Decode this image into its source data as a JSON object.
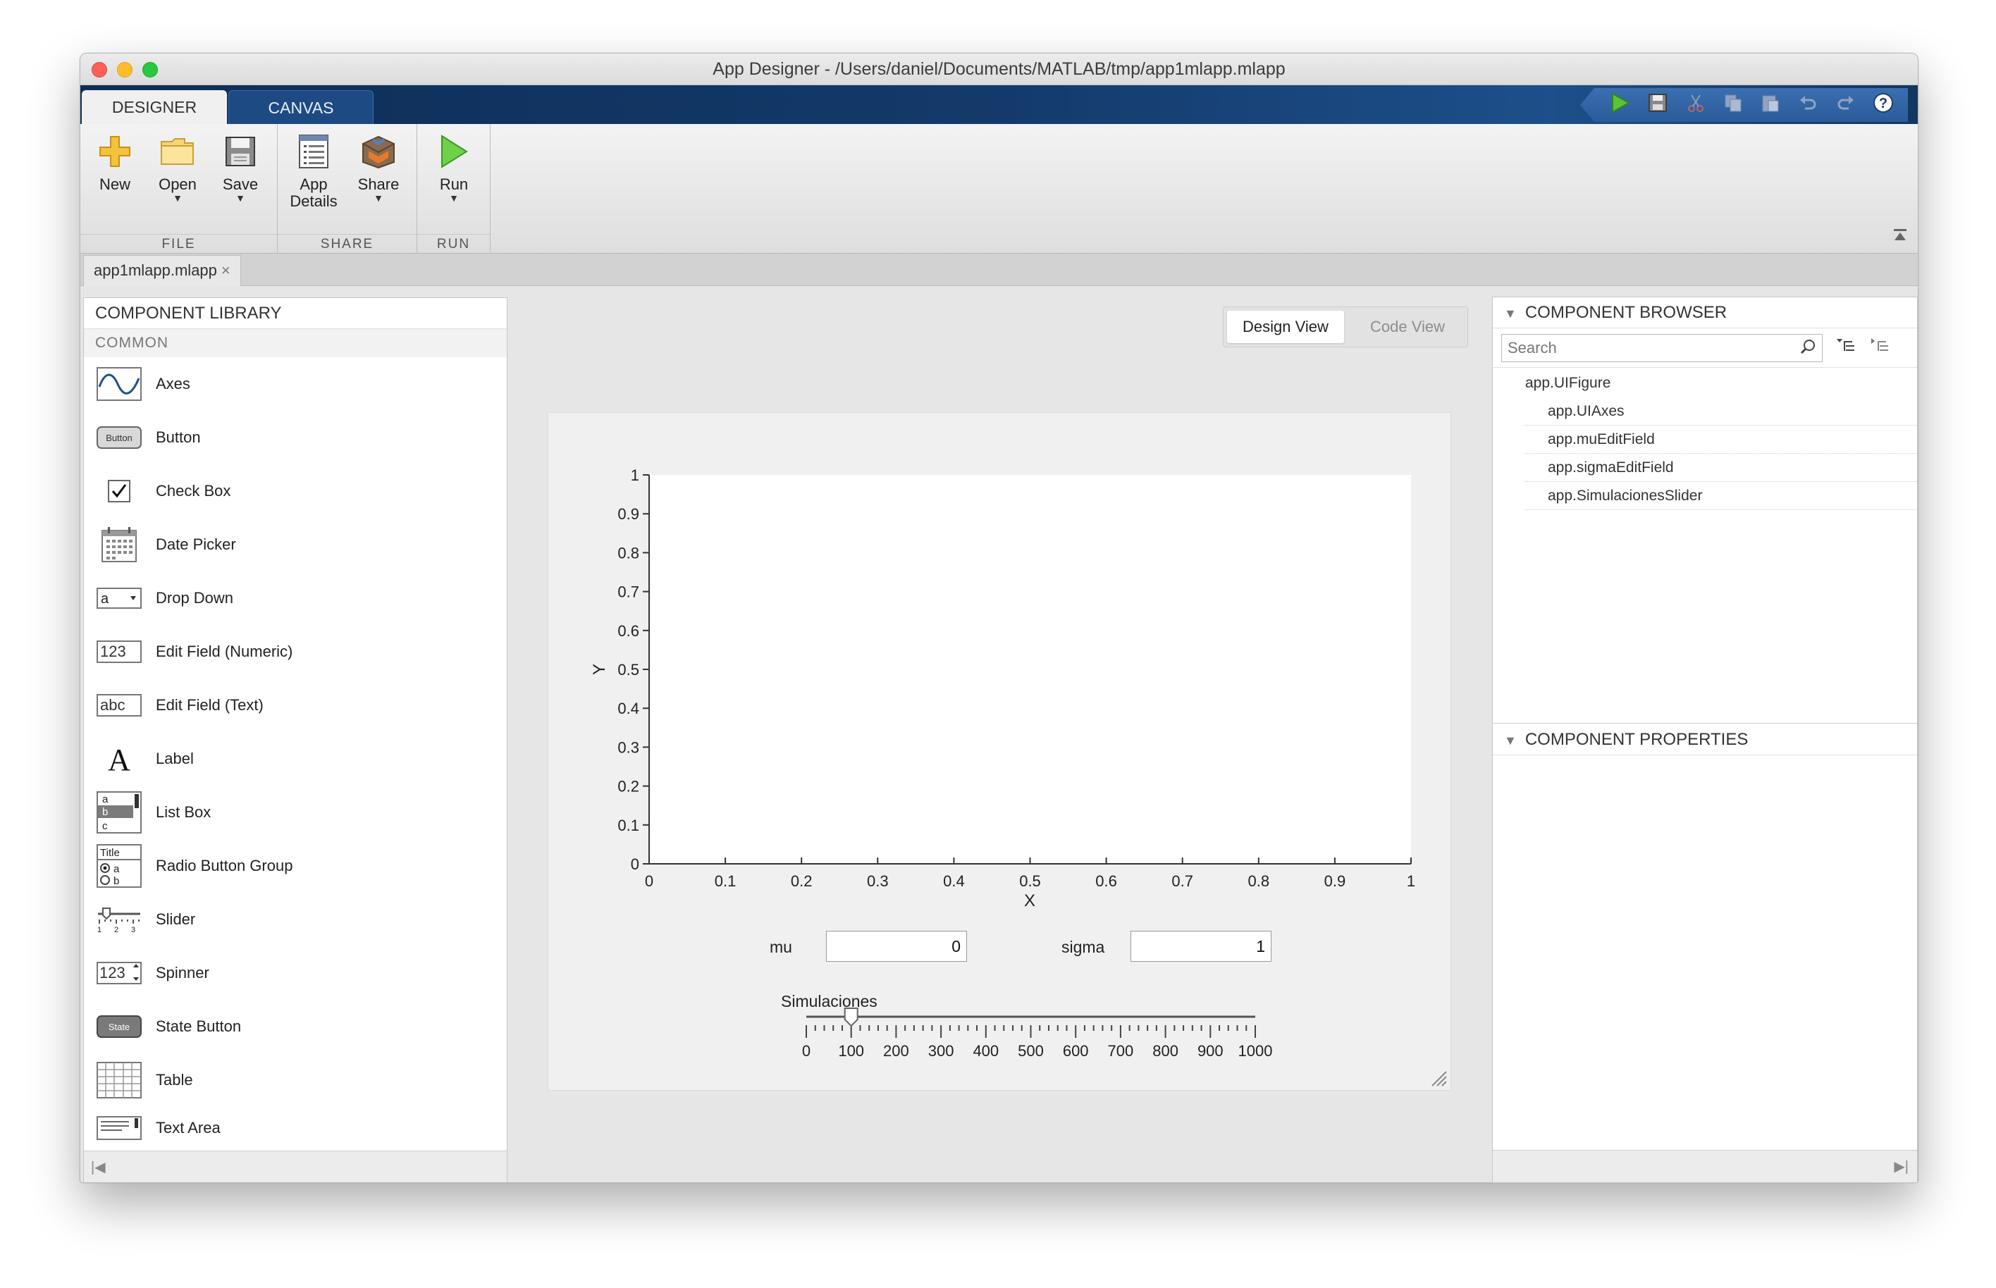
{
  "window": {
    "title": "App Designer - /Users/daniel/Documents/MATLAB/tmp/app1mlapp.mlapp"
  },
  "tabs": {
    "designer": "DESIGNER",
    "canvas": "CANVAS"
  },
  "quick_access": [
    "run-icon",
    "save-icon",
    "cut-icon",
    "copy-icon",
    "paste-icon",
    "undo-icon",
    "redo-icon",
    "help-icon"
  ],
  "toolstrip": {
    "file": {
      "label": "FILE",
      "new": "New",
      "open": "Open",
      "save": "Save"
    },
    "share": {
      "label": "SHARE",
      "app_details_1": "App",
      "app_details_2": "Details",
      "share": "Share"
    },
    "run": {
      "label": "RUN",
      "run": "Run"
    }
  },
  "document_tab": {
    "name": "app1mlapp.mlapp",
    "close": "×"
  },
  "library": {
    "header": "COMPONENT LIBRARY",
    "section": "COMMON",
    "items": [
      {
        "label": "Axes",
        "icon": "axes-icon"
      },
      {
        "label": "Button",
        "icon": "button-icon",
        "icon_text": "Button"
      },
      {
        "label": "Check Box",
        "icon": "checkbox-icon"
      },
      {
        "label": "Date Picker",
        "icon": "date-picker-icon"
      },
      {
        "label": "Drop Down",
        "icon": "dropdown-icon",
        "icon_text": "a"
      },
      {
        "label": "Edit Field (Numeric)",
        "icon": "numeric-field-icon",
        "icon_text": "123"
      },
      {
        "label": "Edit Field (Text)",
        "icon": "text-field-icon",
        "icon_text": "abc"
      },
      {
        "label": "Label",
        "icon": "label-icon",
        "icon_text": "A"
      },
      {
        "label": "List Box",
        "icon": "listbox-icon"
      },
      {
        "label": "Radio Button Group",
        "icon": "radio-group-icon",
        "icon_text": "Title"
      },
      {
        "label": "Slider",
        "icon": "slider-icon"
      },
      {
        "label": "Spinner",
        "icon": "spinner-icon",
        "icon_text": "123"
      },
      {
        "label": "State Button",
        "icon": "state-button-icon",
        "icon_text": "State"
      },
      {
        "label": "Table",
        "icon": "table-icon"
      },
      {
        "label": "Text Area",
        "icon": "text-area-icon"
      }
    ]
  },
  "view_toggle": {
    "design": "Design View",
    "code": "Code View",
    "active": "design"
  },
  "canvas": {
    "axes": {
      "xlabel": "X",
      "ylabel": "Y",
      "xlim": [
        0,
        1
      ],
      "ylim": [
        0,
        1
      ],
      "xticks": [
        "0",
        "0.1",
        "0.2",
        "0.3",
        "0.4",
        "0.5",
        "0.6",
        "0.7",
        "0.8",
        "0.9",
        "1"
      ],
      "yticks": [
        "0",
        "0.1",
        "0.2",
        "0.3",
        "0.4",
        "0.5",
        "0.6",
        "0.7",
        "0.8",
        "0.9",
        "1"
      ]
    },
    "mu": {
      "label": "mu",
      "value": "0"
    },
    "sigma": {
      "label": "sigma",
      "value": "1"
    },
    "slider": {
      "label": "Simulaciones",
      "min": 0,
      "max": 1000,
      "value": 100,
      "ticks": [
        "0",
        "100",
        "200",
        "300",
        "400",
        "500",
        "600",
        "700",
        "800",
        "900",
        "1000"
      ]
    }
  },
  "browser": {
    "header": "COMPONENT BROWSER",
    "search_placeholder": "Search",
    "root": "app.UIFigure",
    "children": [
      "app.UIAxes",
      "app.muEditField",
      "app.sigmaEditField",
      "app.SimulacionesSlider"
    ]
  },
  "properties": {
    "header": "COMPONENT PROPERTIES"
  }
}
